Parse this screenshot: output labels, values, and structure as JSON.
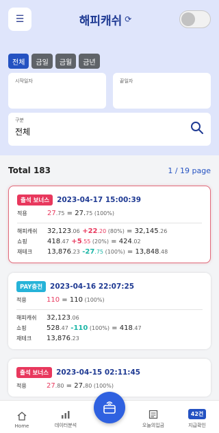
{
  "header": {
    "menu_icon": "☰",
    "title": "해피캐쉬",
    "refresh_icon": "⟳"
  },
  "filters": {
    "chips": [
      "전체",
      "금일",
      "금월",
      "금년"
    ],
    "start_label": "시작일자",
    "end_label": "끝일자",
    "category_label": "구분",
    "category_value": "전체"
  },
  "summary": {
    "total": "Total 183",
    "page": "1 / 19 page"
  },
  "cards": [
    {
      "badge": "출석 보너스",
      "datetime": "2023-04-17 15:00:39",
      "apply": {
        "label": "적용",
        "a_main": "27",
        "a_dec": ".75",
        "eq": " = ",
        "b_main": "27.",
        "b_dec": "75",
        "pct": " (100%)"
      },
      "rows": [
        {
          "label": "해피캐쉬",
          "v_main": "32,123",
          "v_dec": ".06",
          "d_main": " +22",
          "d_dec": ".20",
          "pct": " (80%)",
          "eq": " = ",
          "r_main": "32,145",
          "r_dec": ".26"
        },
        {
          "label": "쇼핑",
          "v_main": "418",
          "v_dec": ".47",
          "d_main": " +5",
          "d_dec": ".55",
          "pct": " (20%)",
          "eq": " = ",
          "r_main": "424",
          "r_dec": ".02"
        },
        {
          "label": "재테크",
          "v_main": "13,876",
          "v_dec": ".23",
          "d_main": " -27",
          "d_dec": ".75",
          "pct": " (100%)",
          "eq": " = ",
          "r_main": "13,848",
          "r_dec": ".48"
        }
      ]
    },
    {
      "badge": "PAY충전",
      "datetime": "2023-04-16 22:07:25",
      "apply": {
        "label": "적용",
        "a_main": "110",
        "eq": " = ",
        "b_main": "110",
        "pct": " (100%)"
      },
      "rows": [
        {
          "label": "해피캐쉬",
          "v_main": "32,123",
          "v_dec": ".06"
        },
        {
          "label": "쇼핑",
          "v_main": "528",
          "v_dec": ".47",
          "d_main": " -110",
          "pct": " (100%)",
          "eq": " = ",
          "r_main": "418",
          "r_dec": ".47"
        },
        {
          "label": "재테크",
          "v_main": "13,876",
          "v_dec": ".23"
        }
      ]
    },
    {
      "badge": "출석 보너스",
      "datetime": "2023-04-15 02:11:45",
      "apply": {
        "label": "적용",
        "a_main": "27",
        "a_dec": ".80",
        "eq": " = ",
        "b_main": "27.",
        "b_dec": "80",
        "pct": " (100%)"
      }
    }
  ],
  "nav": {
    "home": "Home",
    "analysis": "데이터분석",
    "today": "오늘의입금",
    "count": "42건",
    "payment": "지급확인"
  },
  "colors": {
    "accent": "#2452c2",
    "badge_red": "#e8385d",
    "badge_cyan": "#26b3d8",
    "positive": "#e8385d",
    "negative": "#1bb6a6"
  }
}
